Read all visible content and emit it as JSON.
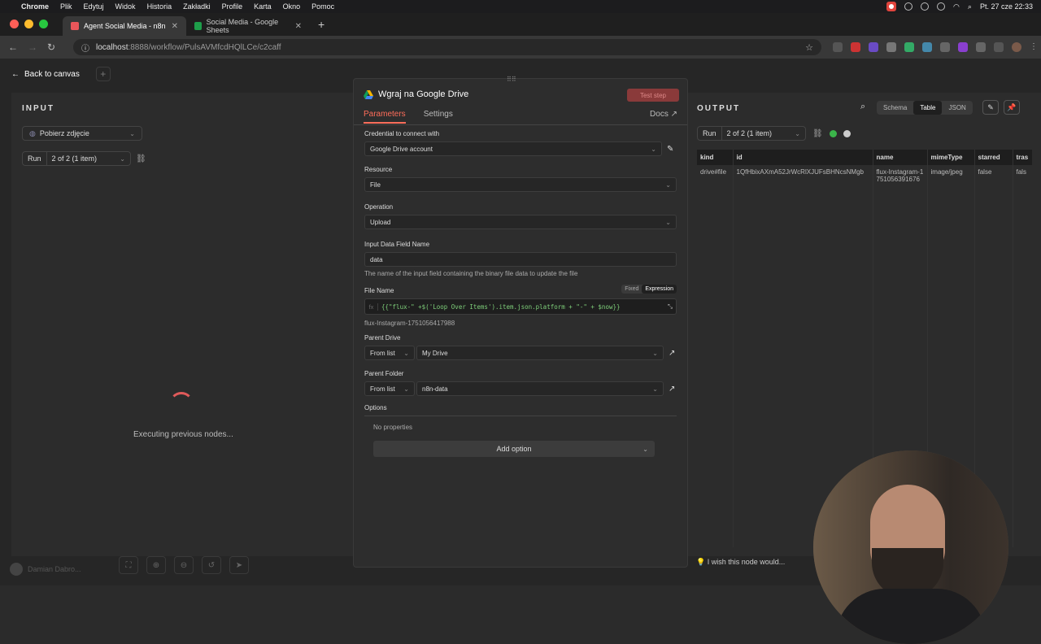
{
  "menubar": {
    "app": "Chrome",
    "menus": [
      "Plik",
      "Edytuj",
      "Widok",
      "Historia",
      "Zakładki",
      "Profile",
      "Karta",
      "Okno",
      "Pomoc"
    ],
    "clock": "Pt. 27 cze  22:33"
  },
  "tabs": [
    {
      "title": "Agent Social Media - n8n",
      "fav_color": "#e8565a"
    },
    {
      "title": "Social Media - Google Sheets",
      "fav_color": "#1e9e4a"
    }
  ],
  "address": {
    "host": "localhost",
    "rest": ":8888/workflow/PulsAVMfcdHQlLCe/c2caff"
  },
  "canvas": {
    "back_label": "Back to canvas"
  },
  "input_panel": {
    "heading": "INPUT",
    "node_select": "Pobierz zdjęcie",
    "run_label": "Run",
    "run_select": "2 of 2 (1 item)",
    "loading_text": "Executing previous nodes..."
  },
  "modal": {
    "title": "Wgraj na Google Drive",
    "test_step": "Test step",
    "tab_parameters": "Parameters",
    "tab_settings": "Settings",
    "docs": "Docs",
    "credential_label": "Credential to connect with",
    "credential_value": "Google Drive account",
    "resource_label": "Resource",
    "resource_value": "File",
    "operation_label": "Operation",
    "operation_value": "Upload",
    "input_field_label": "Input Data Field Name",
    "input_field_value": "data",
    "input_field_hint": "The name of the input field containing the binary file data to update the file",
    "filename_label": "File Name",
    "fixed": "Fixed",
    "expression": "Expression",
    "filename_expr": "{{\"flux-\" +$('Loop Over Items').item.json.platform + \"-\" + $now}}",
    "filename_preview": "flux-Instagram-1751056417988",
    "parent_drive_label": "Parent Drive",
    "parent_drive_mode": "From list",
    "parent_drive_value": "My Drive",
    "parent_folder_label": "Parent Folder",
    "parent_folder_mode": "From list",
    "parent_folder_value": "n8n-data",
    "options_label": "Options",
    "no_properties": "No properties",
    "add_option": "Add option"
  },
  "output_panel": {
    "heading": "OUTPUT",
    "views": [
      "Schema",
      "Table",
      "JSON"
    ],
    "active_view": "Table",
    "run_label": "Run",
    "run_select": "2 of 2 (1 item)",
    "columns": [
      "kind",
      "id",
      "name",
      "mimeType",
      "starred",
      "tras"
    ],
    "row": [
      "drive#file",
      "1QfHbixAXmA52JrWcRlXJUFsBHNcsNMgb",
      "flux-Instagram-1751056391676",
      "image/jpeg",
      "false",
      "fals"
    ]
  },
  "footer": {
    "wish": "I wish this node would...",
    "user": "Damian Dabro..."
  }
}
